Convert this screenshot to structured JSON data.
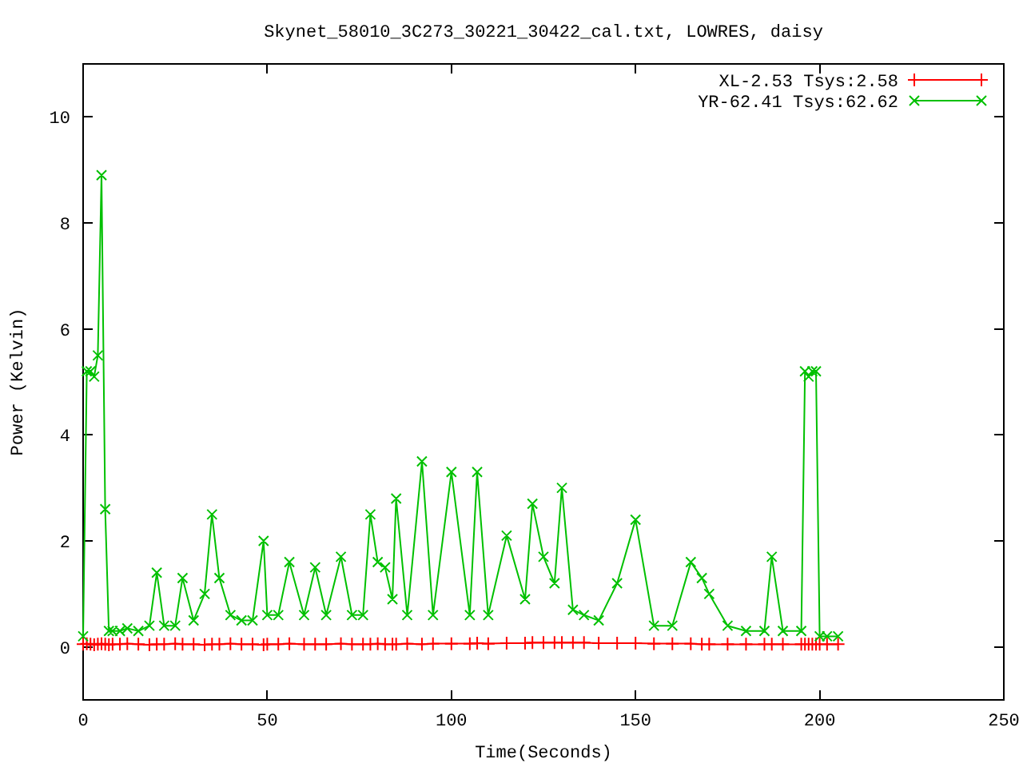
{
  "chart": {
    "chart_data": {
      "type": "line",
      "title": "Skynet_58010_3C273_30221_30422_cal.txt, LOWRES, daisy",
      "xlabel": "Time(Seconds)",
      "ylabel": "Power (Kelvin)",
      "x": [
        0,
        1,
        2,
        3,
        4,
        5,
        6,
        7,
        8,
        10,
        12,
        15,
        18,
        20,
        22,
        25,
        27,
        30,
        33,
        35,
        37,
        40,
        43,
        46,
        49,
        50,
        53,
        56,
        60,
        63,
        66,
        70,
        73,
        76,
        78,
        80,
        82,
        84,
        85,
        88,
        92,
        95,
        100,
        105,
        107,
        110,
        115,
        120,
        122,
        125,
        128,
        130,
        133,
        136,
        140,
        145,
        150,
        155,
        160,
        165,
        168,
        170,
        175,
        180,
        185,
        187,
        190,
        195,
        196,
        197,
        198,
        199,
        200,
        202,
        205
      ],
      "series": [
        {
          "name": "XL-2.53 Tsys:2.58",
          "color": "#ff0000",
          "marker": "plus",
          "values": [
            0.05,
            0.06,
            0.05,
            0.04,
            0.05,
            0.06,
            0.05,
            0.04,
            0.05,
            0.05,
            0.06,
            0.05,
            0.04,
            0.05,
            0.05,
            0.06,
            0.05,
            0.05,
            0.04,
            0.05,
            0.05,
            0.06,
            0.05,
            0.05,
            0.04,
            0.05,
            0.05,
            0.06,
            0.05,
            0.05,
            0.05,
            0.06,
            0.05,
            0.05,
            0.05,
            0.06,
            0.05,
            0.05,
            0.05,
            0.06,
            0.05,
            0.06,
            0.06,
            0.06,
            0.07,
            0.06,
            0.07,
            0.07,
            0.08,
            0.08,
            0.08,
            0.08,
            0.08,
            0.08,
            0.07,
            0.07,
            0.07,
            0.06,
            0.06,
            0.06,
            0.05,
            0.05,
            0.05,
            0.05,
            0.05,
            0.05,
            0.05,
            0.05,
            0.05,
            0.05,
            0.05,
            0.05,
            0.05,
            0.05,
            0.05
          ]
        },
        {
          "name": "YR-62.41 Tsys:62.62",
          "color": "#00c000",
          "marker": "x",
          "values": [
            0.2,
            5.2,
            5.2,
            5.1,
            5.5,
            8.9,
            2.6,
            0.3,
            0.3,
            0.3,
            0.35,
            0.3,
            0.4,
            1.4,
            0.4,
            0.4,
            1.3,
            0.5,
            1.0,
            2.5,
            1.3,
            0.6,
            0.5,
            0.5,
            2.0,
            0.6,
            0.6,
            1.6,
            0.6,
            1.5,
            0.6,
            1.7,
            0.6,
            0.6,
            2.5,
            1.6,
            1.5,
            0.9,
            2.8,
            0.6,
            3.5,
            0.6,
            3.3,
            0.6,
            3.3,
            0.6,
            2.1,
            0.9,
            2.7,
            1.7,
            1.2,
            3.0,
            0.7,
            0.6,
            0.5,
            1.2,
            2.4,
            0.4,
            0.4,
            1.6,
            1.3,
            1.0,
            0.4,
            0.3,
            0.3,
            1.7,
            0.3,
            0.3,
            5.2,
            5.1,
            5.2,
            5.2,
            0.2,
            0.2,
            0.2
          ]
        }
      ],
      "legend": true,
      "xlim": [
        0,
        250
      ],
      "ylim": [
        -1,
        11
      ],
      "xticks": [
        0,
        50,
        100,
        150,
        200,
        250
      ],
      "yticks": [
        0,
        2,
        4,
        6,
        8,
        10
      ]
    }
  }
}
